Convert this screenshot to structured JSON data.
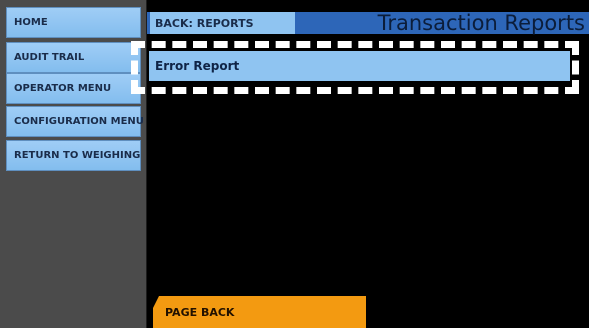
{
  "sidebar": {
    "items": [
      {
        "label": "HOME"
      },
      {
        "label": "AUDIT TRAIL"
      },
      {
        "label": "OPERATOR MENU"
      },
      {
        "label": "CONFIGURATION MENU"
      },
      {
        "label": "RETURN TO WEIGHING"
      }
    ]
  },
  "header": {
    "back_label": "BACK: REPORTS",
    "title": "Transaction Reports"
  },
  "main": {
    "report_items": [
      {
        "label": "Error Report"
      }
    ]
  },
  "footer": {
    "page_back_label": "PAGE BACK"
  },
  "colors": {
    "button_blue": "#8fc4f1",
    "header_blue": "#2d66b8",
    "sidebar_bg": "#4b4b4b",
    "main_bg": "#000000",
    "accent_orange": "#f39a11",
    "selection_outline": "#ffffff"
  }
}
